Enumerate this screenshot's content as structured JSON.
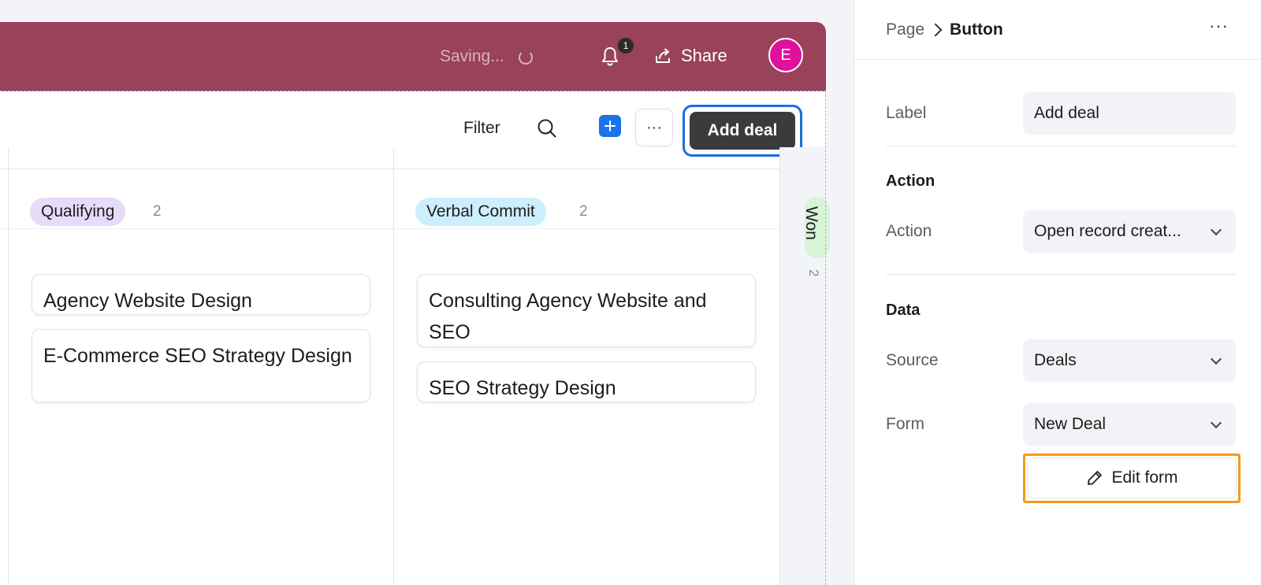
{
  "header": {
    "saving_text": "Saving...",
    "notification_count": "1",
    "share_label": "Share",
    "avatar_initial": "E",
    "brand_color": "#9a4259"
  },
  "toolbar": {
    "filter_label": "Filter",
    "add_deal_label": "Add deal"
  },
  "kanban": {
    "columns": [
      {
        "stage": "Qualifying",
        "count": "2",
        "color": "#e6dcf9",
        "cards": [
          "Agency Website Design",
          "E-Commerce SEO Strategy Design"
        ]
      },
      {
        "stage": "Verbal Commit",
        "count": "2",
        "color": "#cdeefb",
        "cards": [
          "Consulting Agency Website and SEO",
          "SEO Strategy Design"
        ]
      },
      {
        "stage": "Won",
        "count": "2",
        "color": "#d8f3d6"
      }
    ]
  },
  "panel": {
    "breadcrumb": {
      "parent": "Page",
      "current": "Button"
    },
    "label_field": {
      "label": "Label",
      "value": "Add deal"
    },
    "action_section": {
      "title": "Action",
      "action_field": {
        "label": "Action",
        "value": "Open record creat..."
      }
    },
    "data_section": {
      "title": "Data",
      "source_field": {
        "label": "Source",
        "value": "Deals"
      },
      "form_field": {
        "label": "Form",
        "value": "New Deal"
      }
    },
    "edit_form_label": "Edit form"
  }
}
